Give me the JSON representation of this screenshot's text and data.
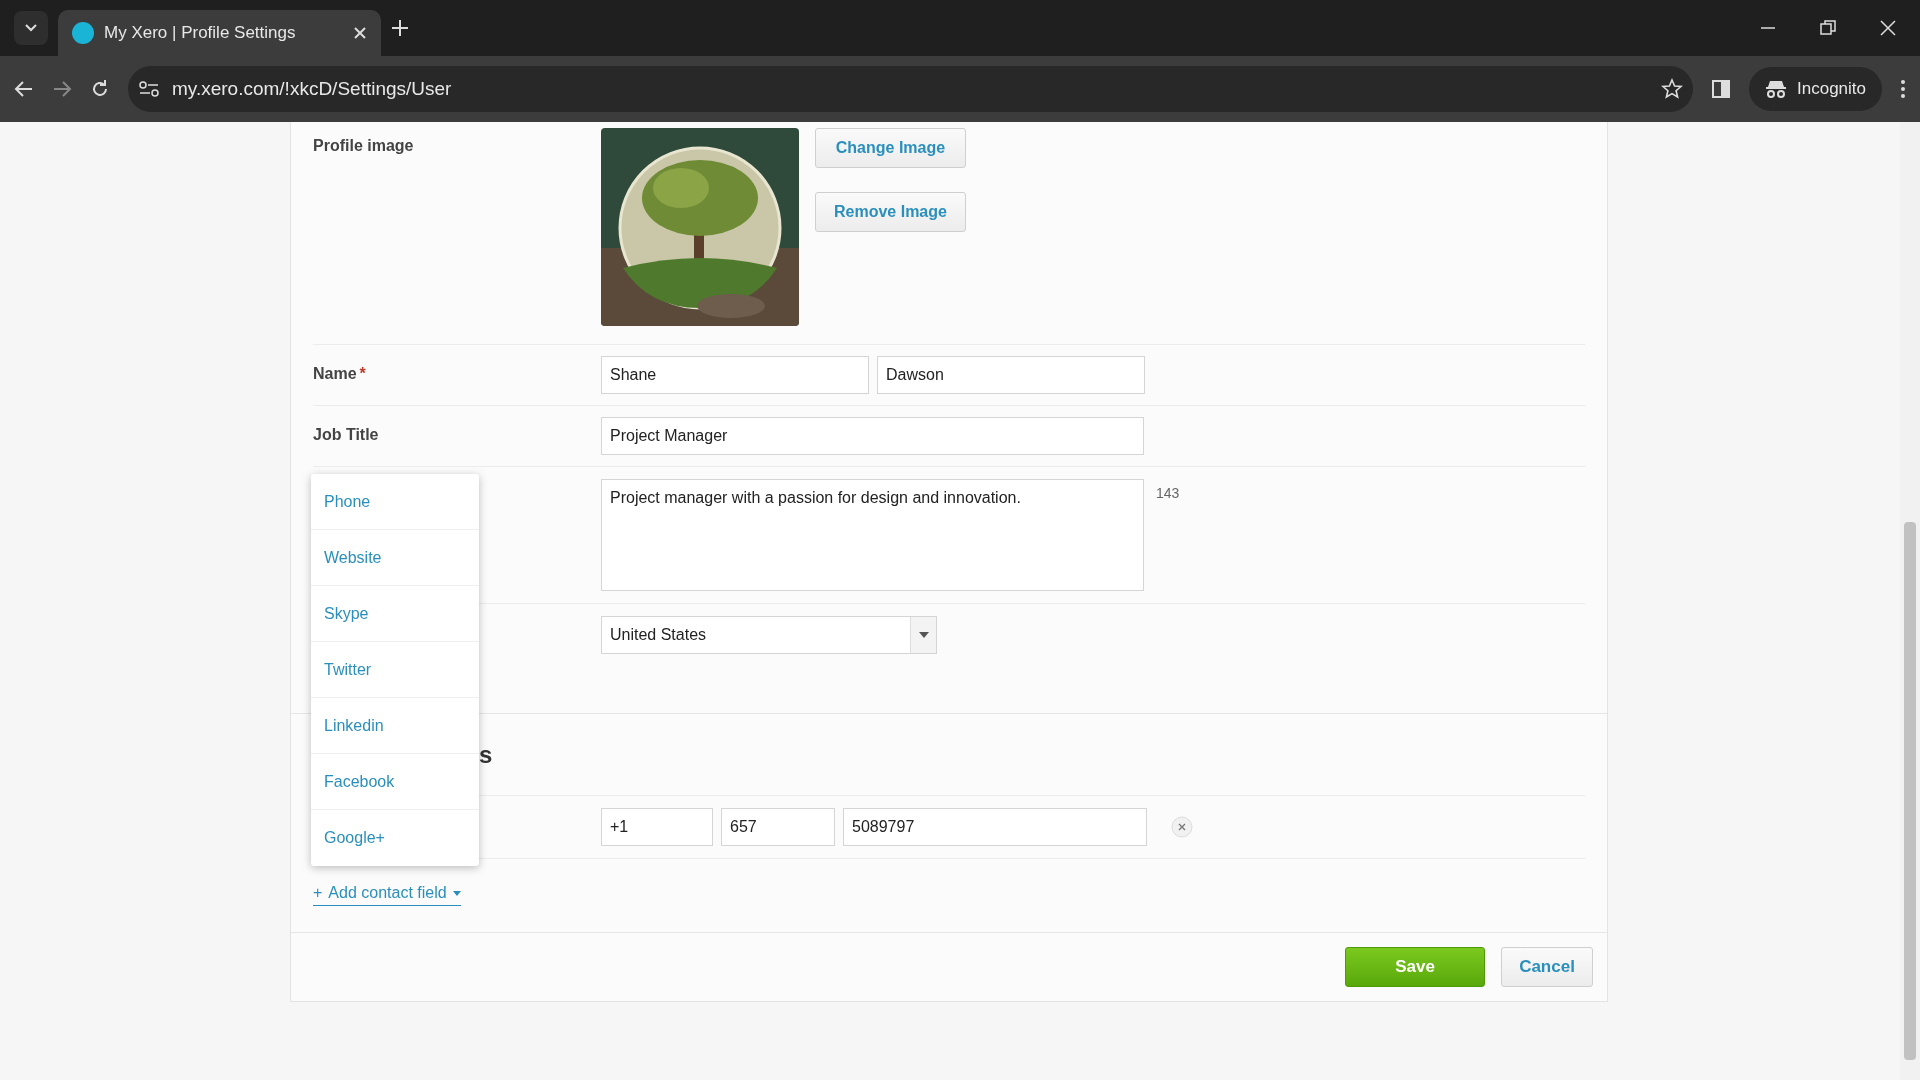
{
  "browser": {
    "tab_title": "My Xero | Profile Settings",
    "url": "my.xero.com/!xkcD/Settings/User",
    "profile_label": "Incognito"
  },
  "profile_image": {
    "label": "Profile image",
    "buttons": [
      "Change Image",
      "Remove Image"
    ]
  },
  "fields": [
    {
      "kind": "name",
      "label": "Name",
      "required_mark": "*",
      "values": [
        "Shane",
        "Dawson"
      ]
    },
    {
      "kind": "text",
      "label": "Job Title",
      "values": [
        "Project Manager"
      ]
    },
    {
      "kind": "textarea",
      "values": [
        "Project manager with a passion for design and innovation."
      ],
      "counter": "143"
    },
    {
      "kind": "select",
      "values": [
        "United States"
      ]
    }
  ],
  "section_heading": "s",
  "contact_rows": [
    {
      "kind": "phone",
      "values": [
        "+1",
        "657",
        "5089797"
      ]
    }
  ],
  "add_contact": {
    "prefix": "+",
    "label": "Add contact field",
    "expanded": true,
    "menu": [
      "Phone",
      "Website",
      "Skype",
      "Twitter",
      "Linkedin",
      "Facebook",
      "Google+"
    ]
  },
  "actions": {
    "save": "Save",
    "cancel": "Cancel"
  }
}
